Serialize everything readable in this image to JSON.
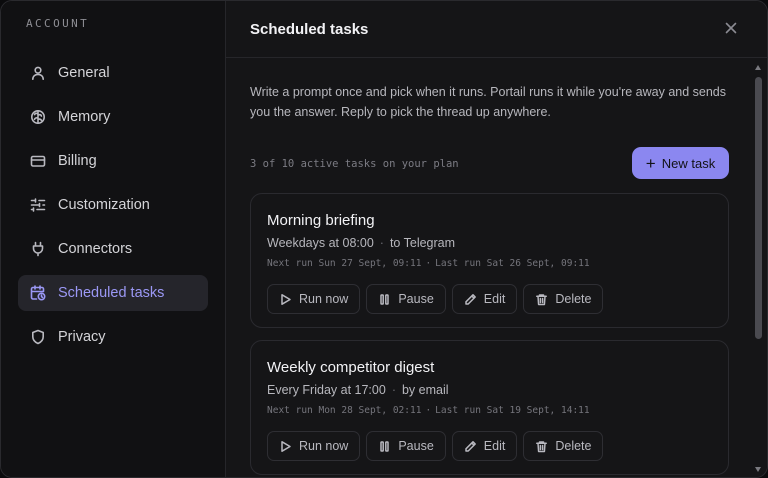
{
  "sidebar": {
    "heading": "ACCOUNT",
    "items": [
      {
        "label": "General",
        "icon": "user-icon"
      },
      {
        "label": "Memory",
        "icon": "brain-icon"
      },
      {
        "label": "Billing",
        "icon": "credit-card-icon"
      },
      {
        "label": "Customization",
        "icon": "sliders-icon"
      },
      {
        "label": "Connectors",
        "icon": "plug-icon"
      },
      {
        "label": "Scheduled tasks",
        "icon": "calendar-clock-icon",
        "active": true
      },
      {
        "label": "Privacy",
        "icon": "shield-icon"
      }
    ]
  },
  "main": {
    "title": "Scheduled tasks",
    "description": "Write a prompt once and pick when it runs. Portail runs it while you're away and sends you the answer. Reply to pick the thread up anywhere.",
    "plan_text": "3 of 10 active tasks on your plan",
    "new_task_label": "New task"
  },
  "tasks": [
    {
      "title": "Morning briefing",
      "schedule": "Weekdays at 08:00",
      "destination": "to Telegram",
      "next_run": "Next run Sun 27 Sept, 09:11",
      "last_run": "Last run Sat 26 Sept, 09:11"
    },
    {
      "title": "Weekly competitor digest",
      "schedule": "Every Friday at 17:00",
      "destination": "by email",
      "next_run": "Next run Mon 28 Sept, 02:11",
      "last_run": "Last run Sat 19 Sept, 14:11"
    }
  ],
  "actions": {
    "run_now": "Run now",
    "pause": "Pause",
    "edit": "Edit",
    "delete": "Delete"
  },
  "separator": "·",
  "colors": {
    "accent": "#8b87f0",
    "active_text": "#9b98f5",
    "background": "#141416"
  }
}
